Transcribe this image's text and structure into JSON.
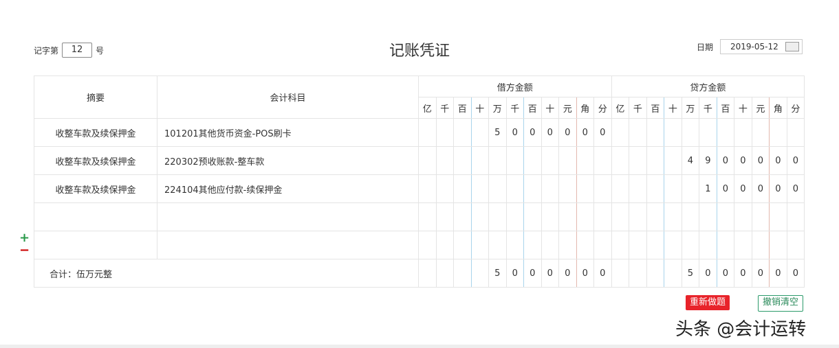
{
  "header": {
    "voucher_prefix": "记字第",
    "voucher_number": "12",
    "voucher_suffix": "号",
    "title": "记账凭证",
    "date_label": "日期",
    "date_value": "2019-05-12"
  },
  "table": {
    "col_summary": "摘要",
    "col_account": "会计科目",
    "debit_header": "借方金额",
    "credit_header": "贷方金额",
    "units": [
      "亿",
      "千",
      "百",
      "十",
      "万",
      "千",
      "百",
      "十",
      "元",
      "角",
      "分"
    ],
    "rows": [
      {
        "summary": "收整车款及续保押金",
        "account": "101201其他货币资金-POS刷卡",
        "debit": [
          "",
          "",
          "",
          "",
          "5",
          "0",
          "0",
          "0",
          "0",
          "0",
          "0"
        ],
        "credit": [
          "",
          "",
          "",
          "",
          "",
          "",
          "",
          "",
          "",
          "",
          ""
        ]
      },
      {
        "summary": "收整车款及续保押金",
        "account": "220302预收账款-整车款",
        "debit": [
          "",
          "",
          "",
          "",
          "",
          "",
          "",
          "",
          "",
          "",
          ""
        ],
        "credit": [
          "",
          "",
          "",
          "",
          "4",
          "9",
          "0",
          "0",
          "0",
          "0",
          "0"
        ]
      },
      {
        "summary": "收整车款及续保押金",
        "account": "224104其他应付款-续保押金",
        "debit": [
          "",
          "",
          "",
          "",
          "",
          "",
          "",
          "",
          "",
          "",
          ""
        ],
        "credit": [
          "",
          "",
          "",
          "",
          "",
          "1",
          "0",
          "0",
          "0",
          "0",
          "0"
        ]
      },
      {
        "summary": "",
        "account": "",
        "debit": [
          "",
          "",
          "",
          "",
          "",
          "",
          "",
          "",
          "",
          "",
          ""
        ],
        "credit": [
          "",
          "",
          "",
          "",
          "",
          "",
          "",
          "",
          "",
          "",
          ""
        ]
      },
      {
        "summary": "",
        "account": "",
        "debit": [
          "",
          "",
          "",
          "",
          "",
          "",
          "",
          "",
          "",
          "",
          ""
        ],
        "credit": [
          "",
          "",
          "",
          "",
          "",
          "",
          "",
          "",
          "",
          "",
          ""
        ]
      }
    ],
    "total": {
      "label": "合计：伍万元整",
      "debit": [
        "",
        "",
        "",
        "",
        "5",
        "0",
        "0",
        "0",
        "0",
        "0",
        "0"
      ],
      "credit": [
        "",
        "",
        "",
        "",
        "5",
        "0",
        "0",
        "0",
        "0",
        "0",
        "0"
      ]
    }
  },
  "controls": {
    "add_row": "+",
    "remove_row": "−",
    "redo": "重新做题",
    "clear": "撤销清空"
  },
  "watermark": "头条 @会计运转"
}
